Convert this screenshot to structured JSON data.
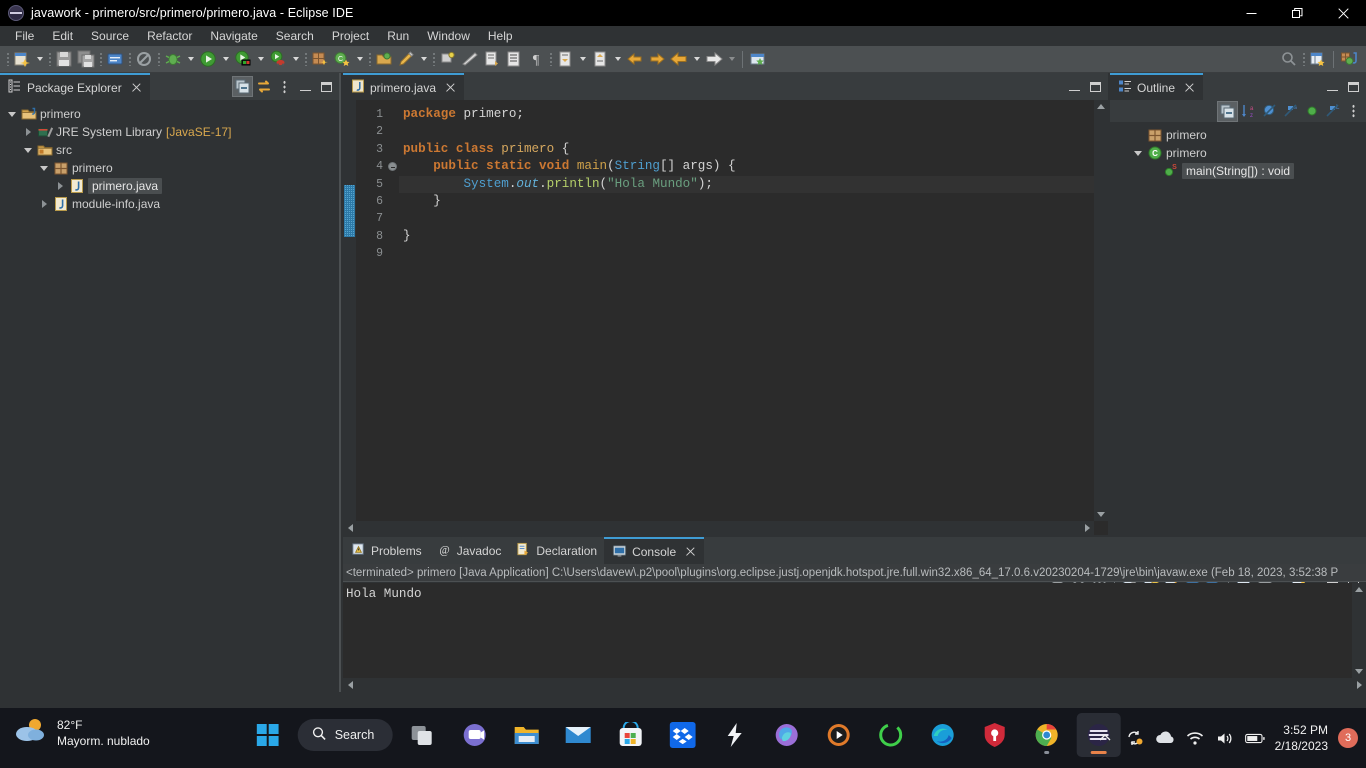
{
  "window": {
    "title": "javawork - primero/src/primero/primero.java - Eclipse IDE",
    "app_icon": "eclipse-icon",
    "minimize_label": "Minimize",
    "maximize_label": "Restore",
    "close_label": "Close"
  },
  "menubar": {
    "items": [
      {
        "label": "File",
        "name": "menu-file"
      },
      {
        "label": "Edit",
        "name": "menu-edit"
      },
      {
        "label": "Source",
        "name": "menu-source"
      },
      {
        "label": "Refactor",
        "name": "menu-refactor"
      },
      {
        "label": "Navigate",
        "name": "menu-navigate"
      },
      {
        "label": "Search",
        "name": "menu-search"
      },
      {
        "label": "Project",
        "name": "menu-project"
      },
      {
        "label": "Run",
        "name": "menu-run"
      },
      {
        "label": "Window",
        "name": "menu-window"
      },
      {
        "label": "Help",
        "name": "menu-help"
      }
    ]
  },
  "toolbar": {
    "items": [
      {
        "name": "new-wizard-button",
        "icon": "new-file-icon",
        "tooltip": "New"
      },
      {
        "name": "new-dropdown",
        "icon": "chevron-down-icon"
      },
      {
        "name": "save-button",
        "icon": "save-icon",
        "tooltip": "Save"
      },
      {
        "name": "save-all-button",
        "icon": "save-all-icon",
        "tooltip": "Save All"
      },
      {
        "name": "print-button",
        "icon": "print-icon",
        "tooltip": "Print"
      },
      {
        "name": "skip-breakpoints-button",
        "icon": "skip-breakpoints-icon"
      },
      {
        "name": "debug-button",
        "icon": "debug-bug-icon",
        "tooltip": "Debug"
      },
      {
        "name": "debug-dropdown",
        "icon": "chevron-down-icon"
      },
      {
        "name": "run-button",
        "icon": "run-play-icon",
        "tooltip": "Run"
      },
      {
        "name": "run-dropdown",
        "icon": "chevron-down-icon"
      },
      {
        "name": "coverage-button",
        "icon": "coverage-icon"
      },
      {
        "name": "coverage-dropdown",
        "icon": "chevron-down-icon"
      },
      {
        "name": "run-ant-button",
        "icon": "run-ant-icon"
      },
      {
        "name": "run-ant-dropdown",
        "icon": "chevron-down-icon"
      },
      {
        "name": "new-java-package-button",
        "icon": "new-package-icon"
      },
      {
        "name": "new-java-class-button",
        "icon": "new-class-icon"
      },
      {
        "name": "new-class-dropdown",
        "icon": "chevron-down-icon"
      },
      {
        "name": "open-type-button",
        "icon": "open-type-icon"
      },
      {
        "name": "quick-access-pencil",
        "icon": "pencil-icon"
      },
      {
        "name": "pencil-dropdown",
        "icon": "chevron-down-icon"
      },
      {
        "name": "toggle-mark-occurrences-button",
        "icon": "mark-occurrences-icon"
      },
      {
        "name": "toggle-ruler-button",
        "icon": "ruler-icon"
      },
      {
        "name": "next-annotation-button",
        "icon": "next-annotation-icon"
      },
      {
        "name": "previous-annotation-button",
        "icon": "previous-annotation-icon"
      },
      {
        "name": "show-whitespace-button",
        "icon": "pilcrow-icon"
      },
      {
        "name": "last-edit-location-button",
        "icon": "last-edit-icon"
      },
      {
        "name": "last-edit-dropdown",
        "icon": "chevron-down-icon"
      },
      {
        "name": "previous-edit-button",
        "icon": "prev-edit-icon"
      },
      {
        "name": "previous-edit-dropdown",
        "icon": "chevron-down-icon"
      },
      {
        "name": "back-history-button",
        "icon": "arrow-left-yellow-icon"
      },
      {
        "name": "forward-history-button",
        "icon": "arrow-right-yellow-icon"
      },
      {
        "name": "back-button",
        "icon": "arrow-left-icon"
      },
      {
        "name": "back-dropdown",
        "icon": "chevron-down-icon"
      },
      {
        "name": "forward-button",
        "icon": "arrow-right-icon"
      },
      {
        "name": "forward-dropdown",
        "icon": "chevron-down-icon"
      },
      {
        "name": "new-window-button",
        "icon": "new-window-icon"
      }
    ],
    "right_items": [
      {
        "name": "quick-search-button",
        "icon": "search-icon"
      },
      {
        "name": "open-perspective-button",
        "icon": "open-perspective-icon"
      },
      {
        "name": "java-perspective-button",
        "icon": "java-perspective-icon",
        "label": "Java"
      }
    ]
  },
  "package_explorer": {
    "tab_label": "Package Explorer",
    "tab_icon": "package-explorer-icon",
    "close_label": "Close",
    "tools": [
      {
        "name": "collapse-all-button",
        "icon": "collapse-all-icon"
      },
      {
        "name": "link-with-editor-button",
        "icon": "link-editor-icon"
      },
      {
        "name": "view-menu-button",
        "icon": "vertical-dots-icon"
      },
      {
        "name": "minimize-button",
        "icon": "minimize-icon"
      },
      {
        "name": "maximize-button",
        "icon": "maximize-icon"
      }
    ],
    "tree": [
      {
        "label": "primero",
        "icon": "java-project-icon",
        "indent": 0,
        "twisty": "down",
        "selected": false,
        "suffix": ""
      },
      {
        "label": "JRE System Library",
        "icon": "jre-library-icon",
        "indent": 1,
        "twisty": "right",
        "selected": false,
        "suffix": "[JavaSE-17]"
      },
      {
        "label": "src",
        "icon": "source-folder-icon",
        "indent": 1,
        "twisty": "down",
        "selected": false,
        "suffix": ""
      },
      {
        "label": "primero",
        "icon": "package-icon",
        "indent": 2,
        "twisty": "down",
        "selected": false,
        "suffix": ""
      },
      {
        "label": "primero.java",
        "icon": "java-file-icon",
        "indent": 3,
        "twisty": "right",
        "selected": true,
        "suffix": ""
      },
      {
        "label": "module-info.java",
        "icon": "java-file-icon",
        "indent": 2,
        "twisty": "right",
        "selected": false,
        "suffix": ""
      }
    ]
  },
  "editor": {
    "tab_label": "primero.java",
    "tab_icon": "java-file-icon",
    "close_label": "Close",
    "minimize_button": "minimize-icon",
    "maximize_button": "maximize-icon",
    "current_line": 5,
    "changed_lines": [
      4,
      5,
      6
    ],
    "fold_line": 4,
    "lines": [
      {
        "n": 1,
        "tokens": [
          {
            "t": "package ",
            "c": "kw"
          },
          {
            "t": "primero;",
            "c": "pln"
          }
        ]
      },
      {
        "n": 2,
        "tokens": []
      },
      {
        "n": 3,
        "tokens": [
          {
            "t": "public ",
            "c": "kw"
          },
          {
            "t": "class ",
            "c": "kw"
          },
          {
            "t": "primero ",
            "c": "cls"
          },
          {
            "t": "{",
            "c": "pln"
          }
        ]
      },
      {
        "n": 4,
        "tokens": [
          {
            "t": "    ",
            "c": "pln"
          },
          {
            "t": "public ",
            "c": "kw"
          },
          {
            "t": "static ",
            "c": "kw"
          },
          {
            "t": "void ",
            "c": "kw"
          },
          {
            "t": "main",
            "c": "mname"
          },
          {
            "t": "(",
            "c": "pln"
          },
          {
            "t": "String",
            "c": "typ"
          },
          {
            "t": "[] args",
            "c": "pln"
          },
          {
            "t": ") {",
            "c": "pln"
          }
        ]
      },
      {
        "n": 5,
        "tokens": [
          {
            "t": "        ",
            "c": "pln"
          },
          {
            "t": "System",
            "c": "typ"
          },
          {
            "t": ".",
            "c": "pln"
          },
          {
            "t": "out",
            "c": "fld"
          },
          {
            "t": ".",
            "c": "pln"
          },
          {
            "t": "println",
            "c": "fn"
          },
          {
            "t": "(",
            "c": "pln"
          },
          {
            "t": "\"Hola Mundo\"",
            "c": "str"
          },
          {
            "t": ");",
            "c": "pln"
          }
        ]
      },
      {
        "n": 6,
        "tokens": [
          {
            "t": "    }",
            "c": "pln"
          }
        ]
      },
      {
        "n": 7,
        "tokens": []
      },
      {
        "n": 8,
        "tokens": [
          {
            "t": "}",
            "c": "pln"
          }
        ]
      },
      {
        "n": 9,
        "tokens": []
      }
    ]
  },
  "outline": {
    "tab_label": "Outline",
    "tab_icon": "outline-icon",
    "close_label": "Close",
    "tools": [
      {
        "name": "collapse-all-button",
        "icon": "collapse-all-icon"
      },
      {
        "name": "sort-button",
        "icon": "sort-az-icon"
      },
      {
        "name": "hide-fields-button",
        "icon": "hide-fields-icon"
      },
      {
        "name": "hide-static-button",
        "icon": "hide-static-icon"
      },
      {
        "name": "hide-non-public-button",
        "icon": "hide-non-public-icon"
      },
      {
        "name": "hide-local-types-button",
        "icon": "hide-local-types-icon"
      },
      {
        "name": "view-menu-button",
        "icon": "vertical-dots-icon"
      },
      {
        "name": "minimize-button",
        "icon": "minimize-icon"
      },
      {
        "name": "maximize-button",
        "icon": "maximize-icon"
      }
    ],
    "tree": [
      {
        "label": "primero",
        "icon": "package-icon",
        "indent": 1,
        "twisty": "none",
        "selected": false
      },
      {
        "label": "primero",
        "icon": "class-icon",
        "indent": 1,
        "twisty": "down",
        "selected": false
      },
      {
        "label": "main(String[]) : void",
        "icon": "method-public-static-icon",
        "indent": 2,
        "twisty": "none",
        "selected": true
      }
    ]
  },
  "console": {
    "tabs": [
      {
        "label": "Problems",
        "icon": "problems-icon",
        "active": false,
        "name": "tab-problems"
      },
      {
        "label": "Javadoc",
        "icon": "javadoc-icon",
        "active": false,
        "name": "tab-javadoc"
      },
      {
        "label": "Declaration",
        "icon": "declaration-icon",
        "active": false,
        "name": "tab-declaration"
      },
      {
        "label": "Console",
        "icon": "console-icon",
        "active": true,
        "name": "tab-console"
      }
    ],
    "close_label": "Close",
    "header": "<terminated> primero [Java Application] C:\\Users\\davew\\.p2\\pool\\plugins\\org.eclipse.justj.openjdk.hotspot.jre.full.win32.x86_64_17.0.6.v20230204-1729\\jre\\bin\\javaw.exe  (Feb 18, 2023, 3:52:38 P",
    "output": "Hola Mundo",
    "tools": [
      {
        "name": "terminate-button",
        "icon": "terminate-stop-icon"
      },
      {
        "name": "remove-launch-button",
        "icon": "remove-launch-icon"
      },
      {
        "name": "remove-all-terminated-button",
        "icon": "remove-all-icon"
      },
      {
        "name": "clear-console-button",
        "icon": "clear-console-icon"
      },
      {
        "name": "scroll-lock-button",
        "icon": "scroll-lock-icon"
      },
      {
        "name": "word-wrap-button",
        "icon": "word-wrap-icon"
      },
      {
        "name": "show-console-on-output-button",
        "icon": "show-console-out-icon"
      },
      {
        "name": "show-console-on-error-button",
        "icon": "show-console-err-icon"
      },
      {
        "name": "pin-console-button",
        "icon": "pin-console-icon"
      },
      {
        "name": "display-selected-console-button",
        "icon": "display-console-icon"
      },
      {
        "name": "display-console-dropdown",
        "icon": "chevron-down-icon"
      },
      {
        "name": "open-console-button",
        "icon": "open-console-icon"
      },
      {
        "name": "open-console-dropdown",
        "icon": "chevron-down-icon"
      },
      {
        "name": "minimize-button",
        "icon": "minimize-icon"
      },
      {
        "name": "maximize-button",
        "icon": "maximize-icon"
      }
    ]
  },
  "statusbar": {
    "left_grip": "grip-icon",
    "right_grip": "grip-icon",
    "quick_fix_icon": "lightbulb-icon"
  },
  "taskbar": {
    "weather": {
      "temperature": "82°F",
      "condition": "Mayorm. nublado",
      "icon": "partly-cloudy-icon"
    },
    "start_button": {
      "name": "start-button",
      "icon": "windows-logo-icon"
    },
    "search": {
      "label": "Search",
      "icon": "search-icon",
      "name": "taskbar-search"
    },
    "apps": [
      {
        "name": "taskbar-task-view",
        "icon": "task-view-icon",
        "active": false,
        "running": false
      },
      {
        "name": "taskbar-teams",
        "icon": "teams-icon",
        "active": false,
        "running": false
      },
      {
        "name": "taskbar-file-explorer",
        "icon": "file-explorer-icon",
        "active": false,
        "running": false
      },
      {
        "name": "taskbar-mail",
        "icon": "mail-icon",
        "active": false,
        "running": false
      },
      {
        "name": "taskbar-microsoft-store",
        "icon": "microsoft-store-icon",
        "active": false,
        "running": false
      },
      {
        "name": "taskbar-dropbox",
        "icon": "dropbox-icon",
        "active": false,
        "running": false
      },
      {
        "name": "taskbar-slack-lightning",
        "icon": "lightning-s-icon",
        "active": false,
        "running": false
      },
      {
        "name": "taskbar-office",
        "icon": "office-copilot-icon",
        "active": false,
        "running": false
      },
      {
        "name": "taskbar-media-player",
        "icon": "media-player-icon",
        "active": false,
        "running": false
      },
      {
        "name": "taskbar-spotify",
        "icon": "green-ring-icon",
        "active": false,
        "running": false
      },
      {
        "name": "taskbar-edge",
        "icon": "edge-icon",
        "active": false,
        "running": false
      },
      {
        "name": "taskbar-password-manager",
        "icon": "shield-key-icon",
        "active": false,
        "running": false
      },
      {
        "name": "taskbar-chrome",
        "icon": "chrome-icon",
        "active": false,
        "running": true
      },
      {
        "name": "taskbar-eclipse",
        "icon": "eclipse-icon",
        "active": true,
        "running": true
      }
    ],
    "tray": [
      {
        "name": "tray-show-hidden",
        "icon": "chevron-up-icon"
      },
      {
        "name": "tray-sync",
        "icon": "sync-icon"
      },
      {
        "name": "tray-onedrive",
        "icon": "onedrive-cloud-icon"
      },
      {
        "name": "tray-network",
        "icon": "wifi-icon"
      },
      {
        "name": "tray-volume",
        "icon": "speaker-icon"
      },
      {
        "name": "tray-battery",
        "icon": "battery-icon"
      }
    ],
    "clock": {
      "time": "3:52 PM",
      "date": "2/18/2023"
    },
    "notifications": {
      "count": "3"
    }
  }
}
